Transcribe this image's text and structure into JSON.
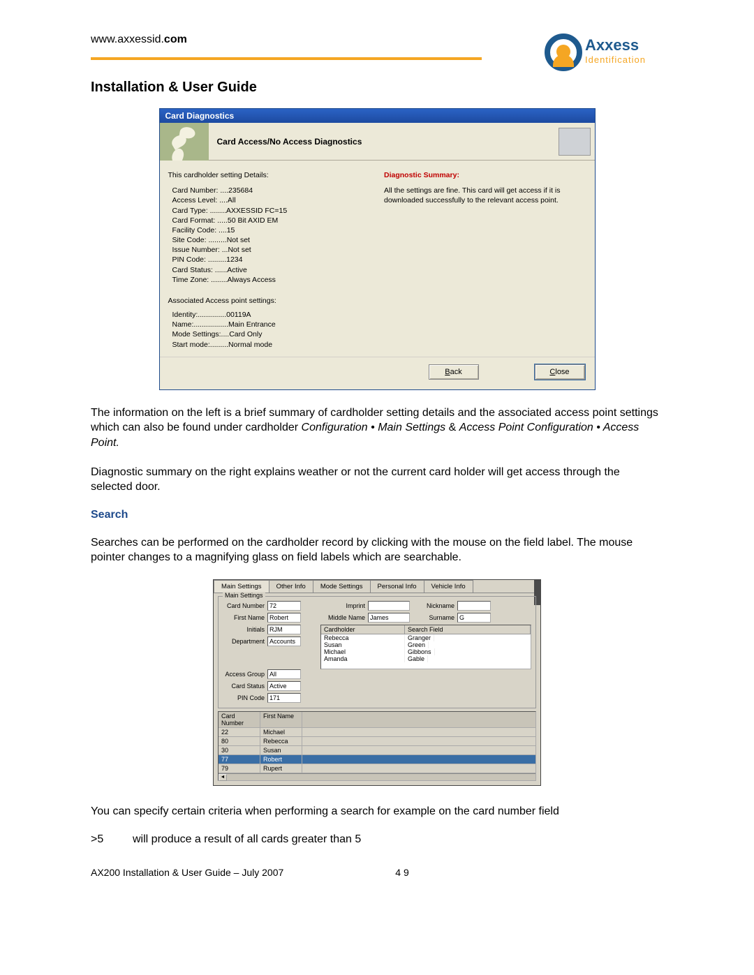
{
  "header": {
    "url_plain": "www.axxessid.",
    "url_bold": "com",
    "logo_text": "Axxess",
    "logo_sub": "Identification"
  },
  "page_title": "Installation & User Guide",
  "dialog1": {
    "title": "Card Diagnostics",
    "banner_title": "Card Access/No Access Diagnostics",
    "left": {
      "heading": "This cardholder setting Details:",
      "lines": [
        "Card Number: ....235684",
        "Access Level: ....All",
        "Card Type: ........AXXESSID FC=15",
        "Card Format: .....50 Bit AXID EM",
        "Facility Code: ....15",
        "Site Code: .........Not set",
        "Issue Number: ...Not set",
        "PIN Code: .........1234",
        "Card Status: ......Active",
        "Time Zone: ........Always Access"
      ],
      "section2": "Associated Access point settings:",
      "lines2": [
        "Identity:..............00119A",
        "Name:.................Main Entrance",
        "Mode Settings:....Card Only",
        "Start mode:.........Normal mode"
      ]
    },
    "right": {
      "heading": "Diagnostic Summary:",
      "body": "All the settings are fine. This card will get access if it is downloaded successfully to the relevant access point."
    },
    "buttons": {
      "back": "Back",
      "close": "Close"
    }
  },
  "para1a": "The information on the left is a brief summary of cardholder setting details and the associated access point settings which can also be found under cardholder ",
  "para1b": "Configuration • Main Settings",
  "para1c": " & ",
  "para1d": "Access Point Configuration • Access Point.",
  "para2": "Diagnostic summary on the right explains weather or not the current card holder will get access through the selected door.",
  "search_heading": "Search",
  "para3": "Searches can be performed on the cardholder record by clicking with the mouse on the field label.  The mouse pointer changes to a magnifying glass on field labels which are searchable.",
  "shot2": {
    "tabs": [
      "Main Settings",
      "Other Info",
      "Mode Settings",
      "Personal Info",
      "Vehicle Info"
    ],
    "group_label": "Main Settings",
    "fields": {
      "card_number_label": "Card Number",
      "card_number": "72",
      "imprint_label": "Imprint",
      "imprint": "",
      "nickname_label": "Nickname",
      "nickname": "",
      "first_name_label": "First Name",
      "first_name": "Robert",
      "middle_name_label": "Middle Name",
      "middle_name": "James",
      "surname_label": "Surname",
      "surname": "G",
      "initials_label": "Initials",
      "initials": "RJM",
      "department_label": "Department",
      "department": "Accounts",
      "access_group_label": "Access Group",
      "access_group": "All",
      "card_status_label": "Card Status",
      "card_status": "Active",
      "pin_code_label": "PIN Code",
      "pin_code": "171"
    },
    "searchgrid": {
      "col1": "Cardholder",
      "col2": "Search Field",
      "rows": [
        [
          "Rebecca",
          "Granger"
        ],
        [
          "Susan",
          "Green"
        ],
        [
          "Michael",
          "Gibbons"
        ],
        [
          "Amanda",
          "Gable"
        ]
      ]
    },
    "bottomgrid": {
      "h1": "Card Number",
      "h2": "First Name",
      "rows": [
        [
          "22",
          "Michael"
        ],
        [
          "80",
          "Rebecca"
        ],
        [
          "30",
          "Susan"
        ],
        [
          "77",
          "Robert"
        ],
        [
          "79",
          "Rupert"
        ]
      ],
      "selected_index": 3
    }
  },
  "para4": "You can specify certain criteria when performing a search for example on the card number field",
  "criteria_op": ">5",
  "criteria_desc": "will produce a result of all cards greater than 5",
  "footer_left": "AX200 Installation & User Guide – July 2007",
  "footer_right": "4 9"
}
